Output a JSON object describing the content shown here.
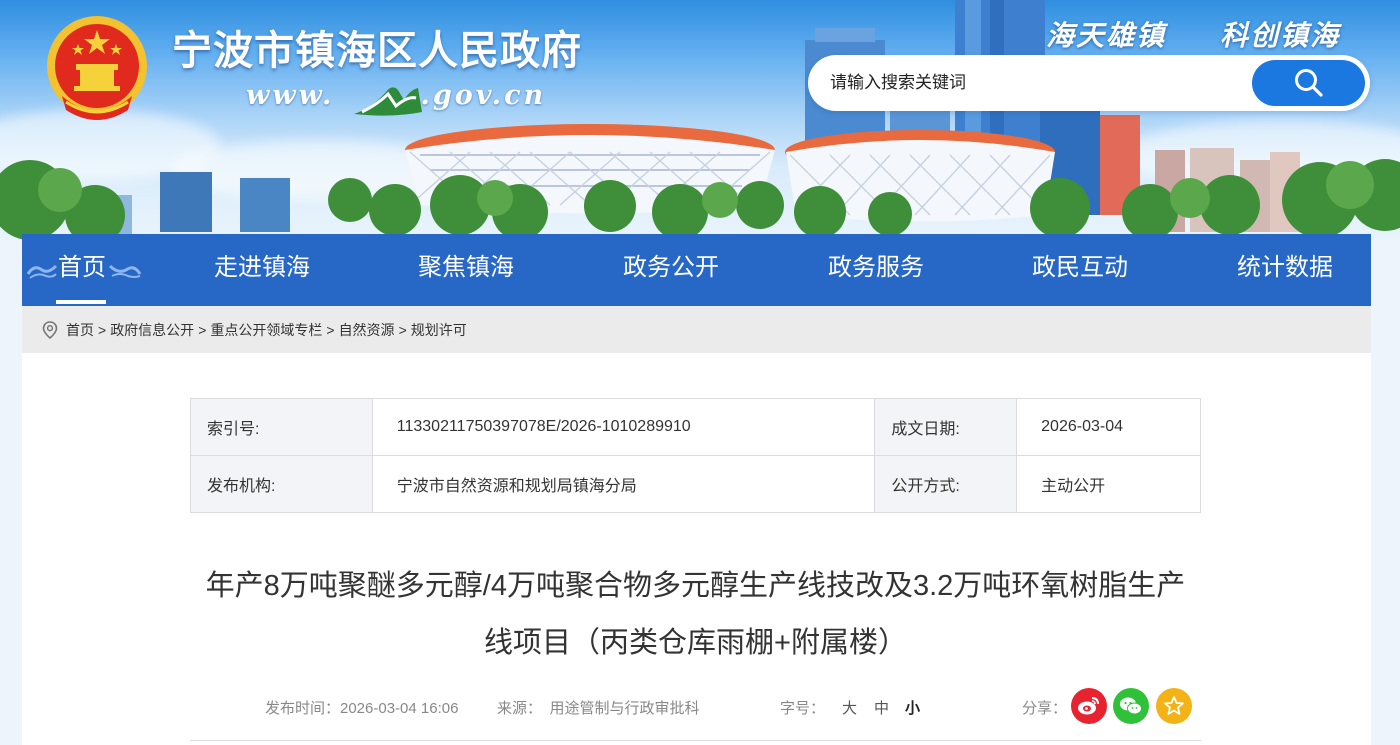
{
  "header": {
    "site_title": "宁波市镇海区人民政府",
    "site_url_prefix": "www.",
    "site_url_suffix": ".gov.cn",
    "slogan_left": "海天雄镇",
    "slogan_right": "科创镇海"
  },
  "search": {
    "placeholder": "请输入搜索关键词"
  },
  "nav": {
    "items": [
      "首页",
      "走进镇海",
      "聚焦镇海",
      "政务公开",
      "政务服务",
      "政民互动",
      "统计数据"
    ],
    "active": "首页"
  },
  "breadcrumb": [
    "首页",
    "政府信息公开",
    "重点公开领域专栏",
    "自然资源",
    "规划许可"
  ],
  "meta": {
    "index_label": "索引号:",
    "index_value": "11330211750397078E/2026-1010289910",
    "date_label": "成文日期:",
    "date_value": "2026-03-04",
    "org_label": "发布机构:",
    "org_value": "宁波市自然资源和规划局镇海分局",
    "mode_label": "公开方式:",
    "mode_value": "主动公开"
  },
  "article": {
    "title_line1": "年产8万吨聚醚多元醇/4万吨聚合物多元醇生产线技改及3.2万吨环氧树脂生产",
    "title_line2": "线项目（丙类仓库雨棚+附属楼）",
    "publish_time": "发布时间：2026-03-04 16:06",
    "source": "来源：　用途管制与行政审批科",
    "font_size_label": "字号：",
    "font_sizes": [
      "大",
      "中",
      "小"
    ],
    "share_label": "分享："
  },
  "colors": {
    "nav_bg": "#2767c6",
    "search_btn": "#1a78e0",
    "weibo": "#e6232e",
    "wechat": "#2fc137",
    "favorite": "#f3b216"
  }
}
